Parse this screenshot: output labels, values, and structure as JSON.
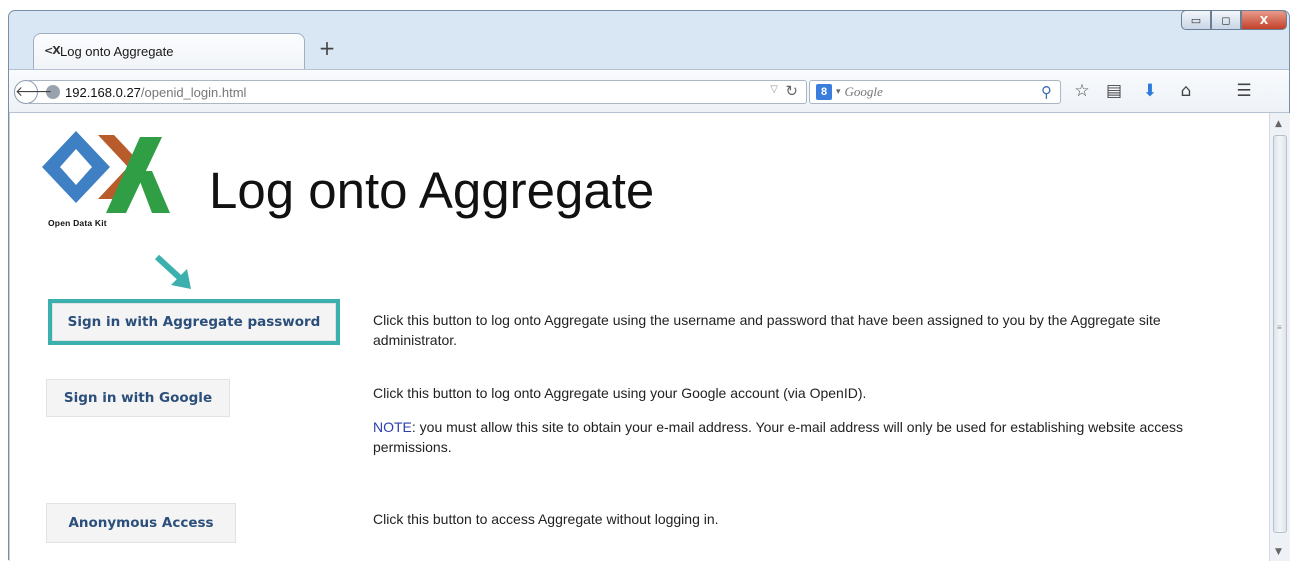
{
  "window": {
    "controls": {
      "minimize": "▭",
      "maximize": "◻",
      "close": "X"
    }
  },
  "tab": {
    "icon": "<X",
    "title": "Log onto Aggregate",
    "new_tab": "+"
  },
  "navbar": {
    "url_host": "192.168.0.27",
    "url_path": "/openid_login.html",
    "search_engine_icon": "8",
    "search_placeholder": "Google"
  },
  "page": {
    "logo_caption": "Open Data Kit",
    "title": "Log onto Aggregate",
    "options": [
      {
        "button": "Sign in with Aggregate password",
        "description": "Click this button to log onto Aggregate using the username and password that have been assigned to you by the Aggregate site administrator."
      },
      {
        "button": "Sign in with Google",
        "description": "Click this button to log onto Aggregate using your Google account (via OpenID).",
        "note_label": "NOTE",
        "note_text": ": you must allow this site to obtain your e-mail address. Your e-mail address will only be used for establishing website access permissions."
      },
      {
        "button": "Anonymous Access",
        "description": "Click this button to access Aggregate without logging in."
      }
    ]
  },
  "colors": {
    "highlight": "#3bb0ae",
    "button_text": "#2b4f7a",
    "note_label": "#2c3fae"
  },
  "icons": [
    "back-icon",
    "globe-icon",
    "reload-icon",
    "search-icon",
    "bookmark-star-icon",
    "reading-list-icon",
    "download-icon",
    "home-icon",
    "menu-icon",
    "pointer-arrow-icon"
  ]
}
